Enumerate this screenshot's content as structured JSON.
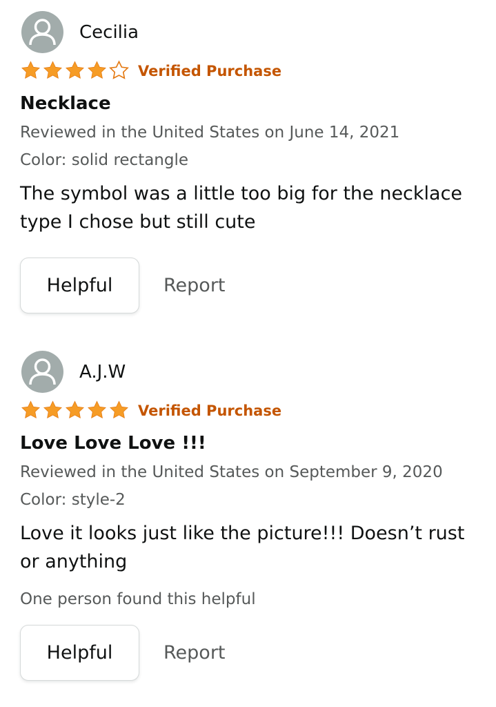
{
  "reviews": [
    {
      "reviewer": "Cecilia",
      "rating": 4,
      "rating_max": 5,
      "verified_label": "Verified Purchase",
      "title": "Necklace",
      "date": "Reviewed in the United States on June 14, 2021",
      "variant": "Color: solid rectangle",
      "body": "The symbol was a little too big for the necklace type I chose but still cute",
      "helpful_count": "",
      "helpful_label": "Helpful",
      "report_label": "Report"
    },
    {
      "reviewer": "A.J.W",
      "rating": 5,
      "rating_max": 5,
      "verified_label": "Verified Purchase",
      "title": "Love Love Love !!!",
      "date": "Reviewed in the United States on September 9, 2020",
      "variant": "Color: style-2",
      "body": "Love it looks just like the picture!!! Doesn’t rust or anything",
      "helpful_count": "One person found this helpful",
      "helpful_label": "Helpful",
      "report_label": "Report"
    }
  ],
  "icons": {
    "avatar": "person-silhouette-icon",
    "star_filled": "star-filled-icon",
    "star_empty": "star-outline-icon"
  },
  "colors": {
    "star": "#f69c26",
    "verified": "#c45500",
    "avatar_bg": "#a2acab",
    "muted_text": "#565959"
  }
}
